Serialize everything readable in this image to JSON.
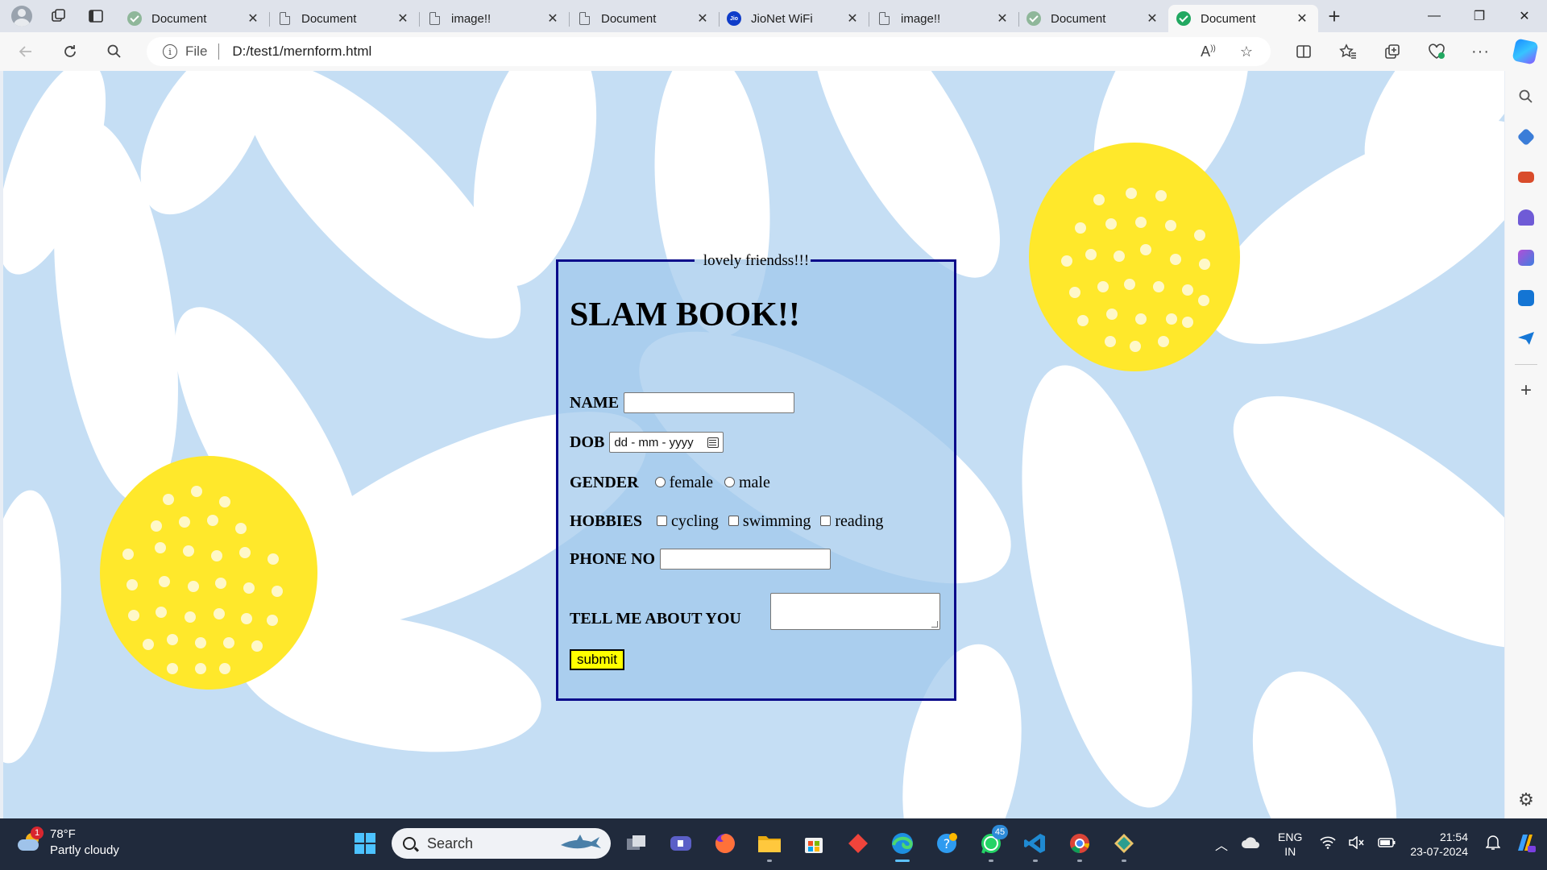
{
  "browser": {
    "tabs": [
      {
        "title": "Document",
        "icon": "check-icon",
        "active": false
      },
      {
        "title": "Document",
        "icon": "document-icon",
        "active": false
      },
      {
        "title": "image!!",
        "icon": "document-icon",
        "active": false
      },
      {
        "title": "Document",
        "icon": "document-icon",
        "active": false
      },
      {
        "title": "JioNet WiFi",
        "icon": "jio-icon",
        "active": false
      },
      {
        "title": "image!!",
        "icon": "document-icon",
        "active": false
      },
      {
        "title": "Document",
        "icon": "check-icon",
        "active": false
      },
      {
        "title": "Document",
        "icon": "check-icon",
        "active": true
      }
    ],
    "tab_close_glyph": "✕",
    "new_tab_glyph": "+",
    "window_controls": {
      "minimize": "—",
      "restore": "❐",
      "close": "✕"
    },
    "address": {
      "scheme_label": "File",
      "url": "D:/test1/mernform.html"
    }
  },
  "form": {
    "legend": "lovely friendss!!!",
    "heading": "SLAM BOOK!!",
    "name_label": "NAME",
    "dob_label": "DOB",
    "dob_placeholder": "dd - mm - yyyy",
    "gender_label": "GENDER",
    "gender_options": [
      "female",
      "male"
    ],
    "hobbies_label": "HOBBIES",
    "hobby_options": [
      "cycling",
      "swimming",
      "reading"
    ],
    "phone_label": "PHONE NO",
    "about_label": "TELL ME ABOUT YOU",
    "submit_label": "submit"
  },
  "taskbar": {
    "weather": {
      "temp": "78°F",
      "condition": "Partly cloudy",
      "badge": "1"
    },
    "search_placeholder": "Search",
    "whatsapp_badge": "45",
    "language": {
      "line1": "ENG",
      "line2": "IN"
    },
    "time": "21:54",
    "date": "23-07-2024"
  },
  "colors": {
    "page_background": "#c5def4",
    "form_border": "#0a0a8a",
    "submit_button": "#ffff00",
    "flower_center": "#ffe82b",
    "taskbar": "#202a3c"
  }
}
